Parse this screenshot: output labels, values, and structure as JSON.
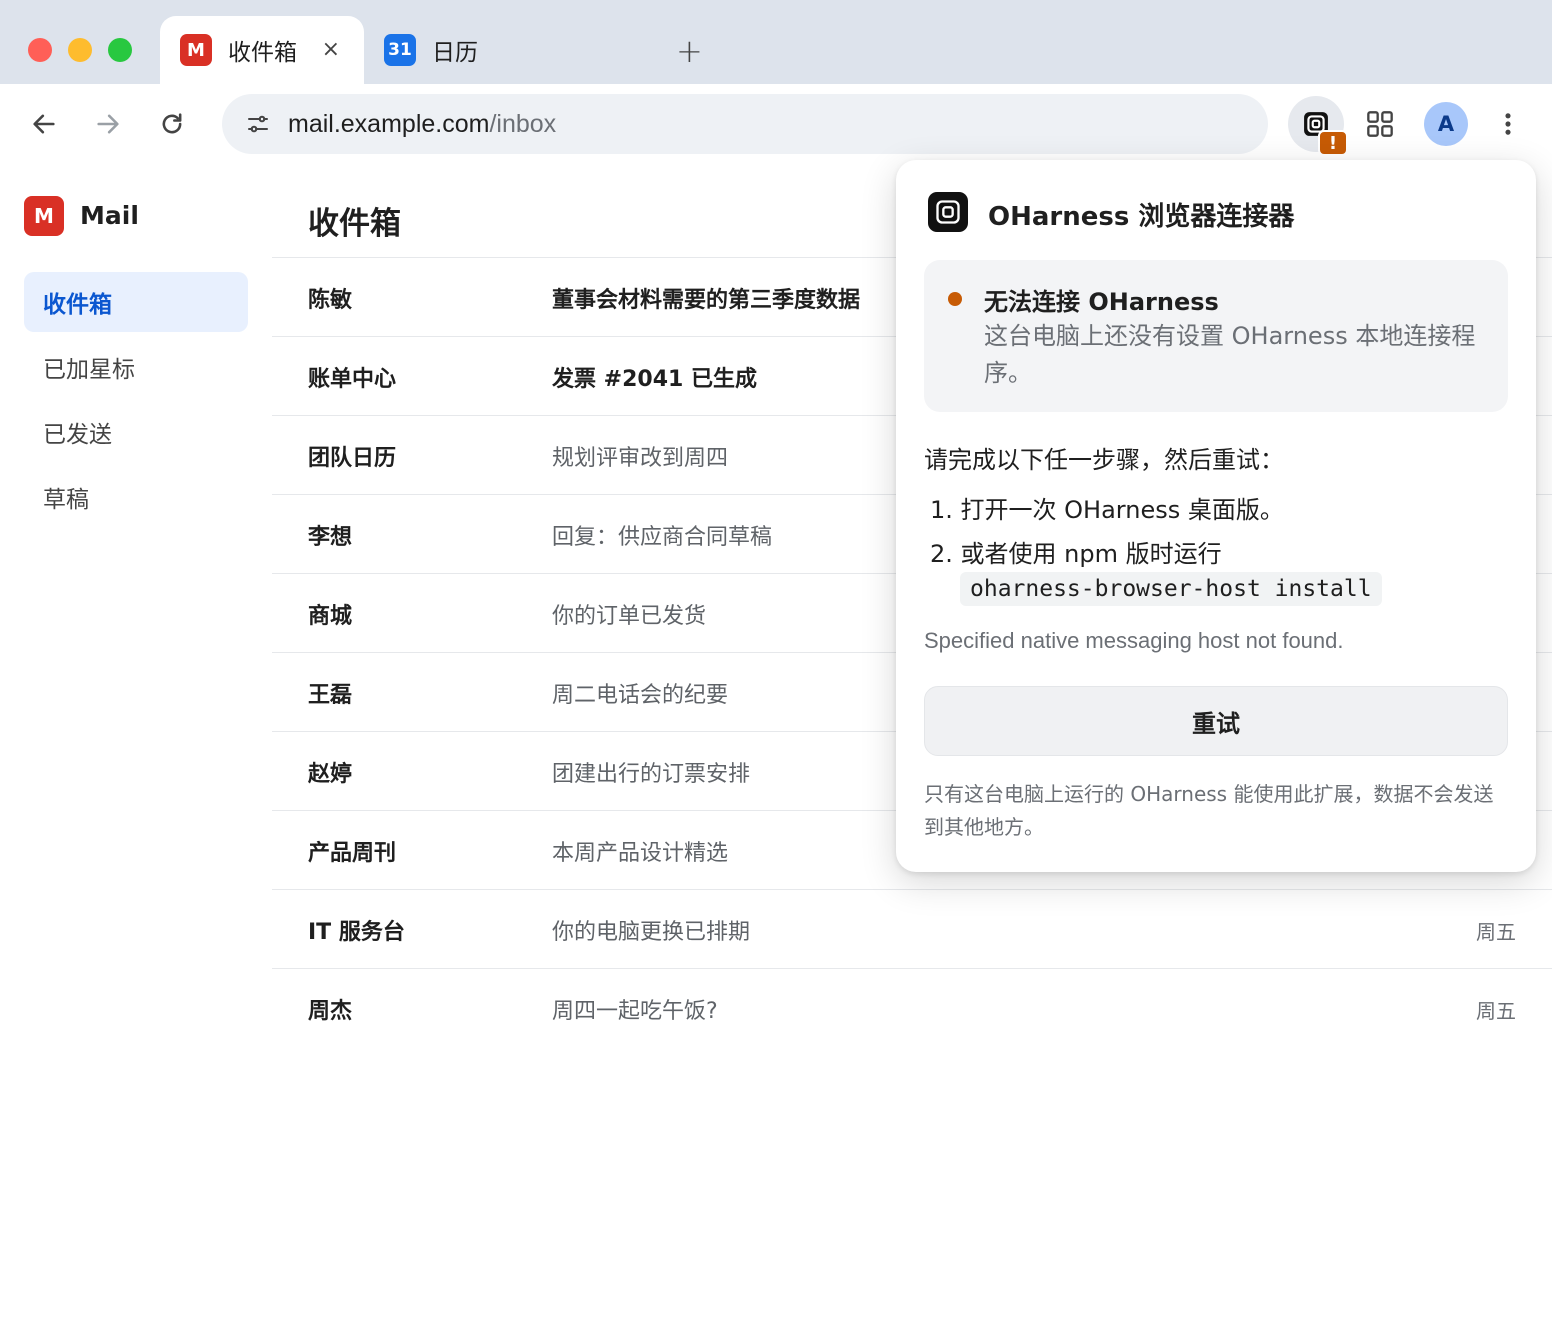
{
  "browser": {
    "tabs": [
      {
        "favicon_label": "M",
        "title": "收件箱",
        "close": "×"
      },
      {
        "favicon_label": "31",
        "title": "日历"
      }
    ],
    "new_tab": "+",
    "url_host": "mail.example.com",
    "url_path": "/inbox",
    "extension_badge": "!",
    "avatar_letter": "A",
    "colors": {
      "tab_strip": "#dde3ec",
      "badge": "#c75b05",
      "avatar": "#a8c7fa"
    }
  },
  "app": {
    "logo_letter": "M",
    "name": "Mail",
    "nav": [
      "收件箱",
      "已加星标",
      "已发送",
      "草稿"
    ],
    "title": "收件箱",
    "accent": "#0b57d0"
  },
  "emails": [
    {
      "sender": "陈敏",
      "subject": "董事会材料需要的第三季度数据",
      "date": ""
    },
    {
      "sender": "账单中心",
      "subject": "发票 #2041 已生成",
      "date": ""
    },
    {
      "sender": "团队日历",
      "subject": "规划评审改到周四",
      "date": ""
    },
    {
      "sender": "李想",
      "subject": "回复：供应商合同草稿",
      "date": ""
    },
    {
      "sender": "商城",
      "subject": "你的订单已发货",
      "date": ""
    },
    {
      "sender": "王磊",
      "subject": "周二电话会的纪要",
      "date": ""
    },
    {
      "sender": "赵婷",
      "subject": "团建出行的订票安排",
      "date": ""
    },
    {
      "sender": "产品周刊",
      "subject": "本周产品设计精选",
      "date": ""
    },
    {
      "sender": "IT 服务台",
      "subject": "你的电脑更换已排期",
      "date": "周五"
    },
    {
      "sender": "周杰",
      "subject": "周四一起吃午饭?",
      "date": "周五"
    }
  ],
  "popup": {
    "title": "OHarness 浏览器连接器",
    "status_title": "无法连接 OHarness",
    "status_desc": "这台电脑上还没有设置 OHarness 本地连接程序。",
    "steps_intro": "请完成以下任一步骤，然后重试：",
    "step1": "1. 打开一次 OHarness 桌面版。",
    "step2": "2. 或者使用 npm 版时运行",
    "command": "oharness-browser-host install",
    "error": "Specified native messaging host not found.",
    "retry_label": "重试",
    "footnote": "只有这台电脑上运行的 OHarness 能使用此扩展，数据不会发送到其他地方。",
    "status_color": "#c75b05"
  }
}
